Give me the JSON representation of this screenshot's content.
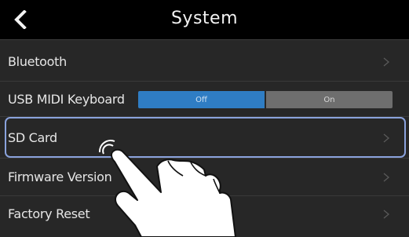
{
  "header": {
    "title": "System",
    "back_icon": "chevron-left-icon"
  },
  "rows": [
    {
      "label": "Bluetooth",
      "chevron": ">"
    },
    {
      "label": "USB MIDI Keyboard",
      "toggle": {
        "off": "Off",
        "on": "On",
        "selected": "Off"
      }
    },
    {
      "label": "SD Card",
      "chevron": ">"
    },
    {
      "label": "Firmware Version",
      "chevron": ">"
    },
    {
      "label": "Factory Reset",
      "chevron": ">"
    }
  ],
  "colors": {
    "background": "#050505",
    "row": "#272727",
    "toggle_off": "#2f7dc4",
    "toggle_on": "#6e6e6e",
    "highlight": "#8aa2dc"
  },
  "overlay": {
    "icon": "tapping-hand-icon"
  }
}
